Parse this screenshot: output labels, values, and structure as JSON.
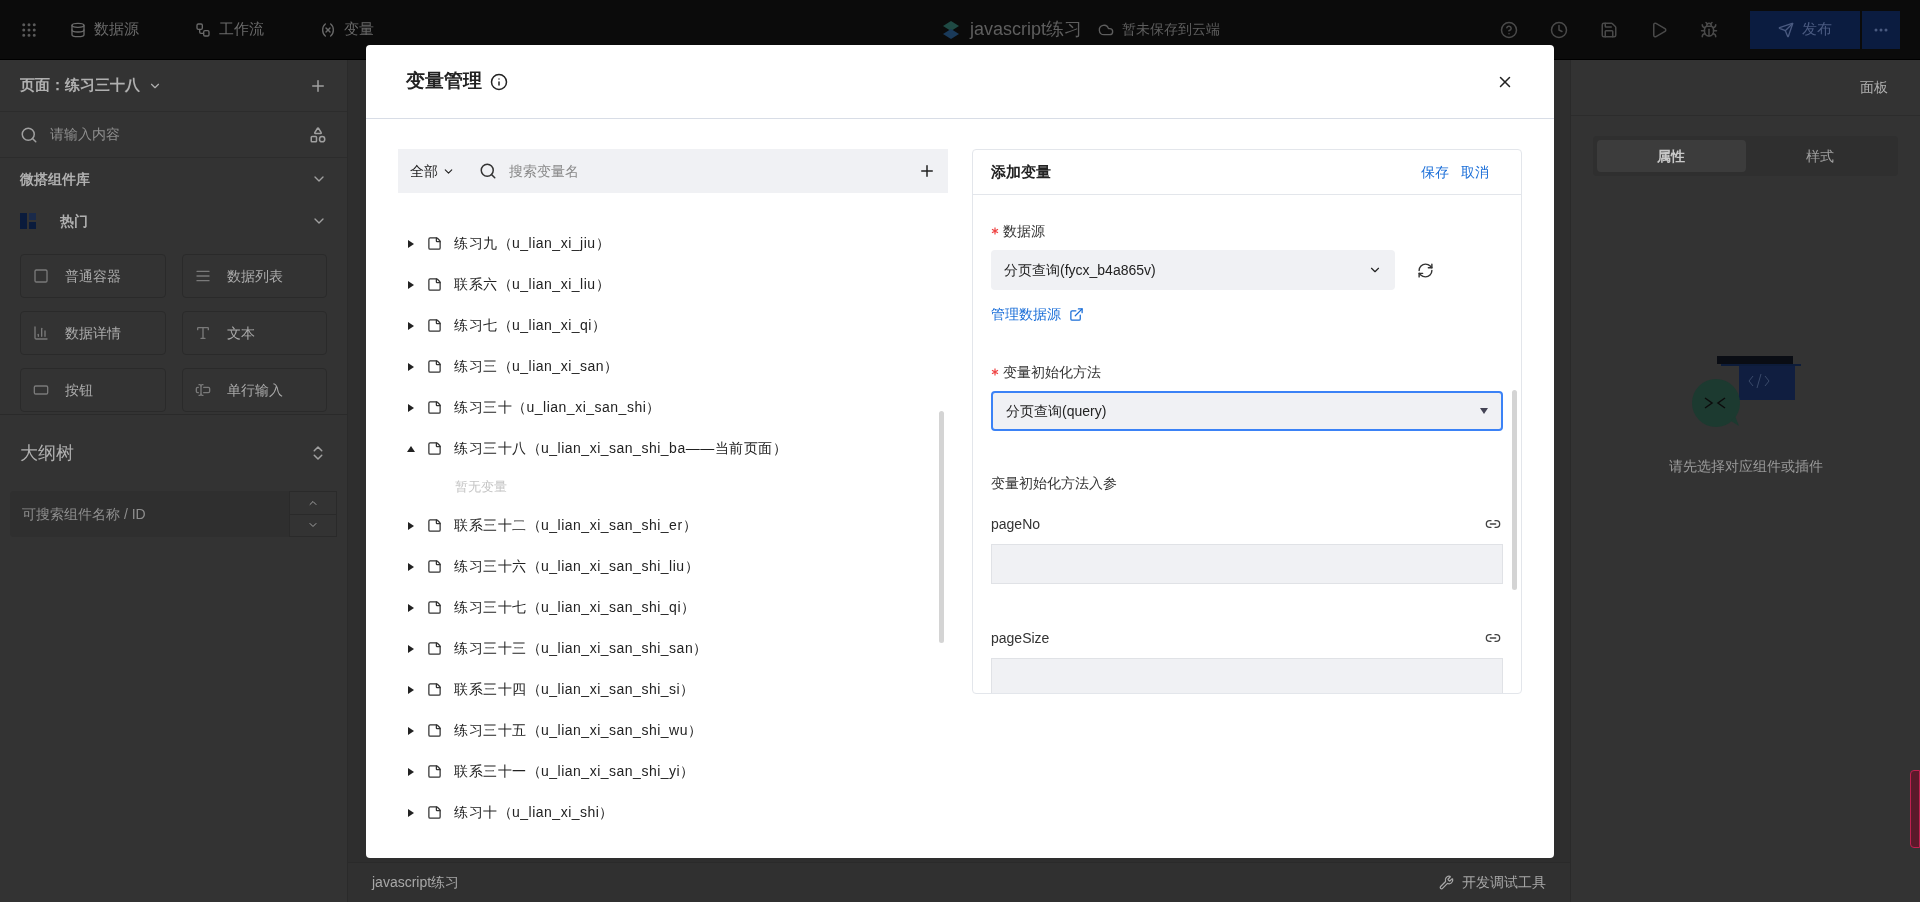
{
  "topbar": {
    "nav": [
      {
        "label": "数据源",
        "kind": "database"
      },
      {
        "label": "工作流",
        "kind": "workflow"
      },
      {
        "label": "变量",
        "kind": "variable"
      }
    ],
    "app_title": "javascript练习",
    "save_status": "暂未保存到云端",
    "publish_button": "发布"
  },
  "left_sidebar": {
    "page_selector": "页面：练习三十八",
    "search": {
      "placeholder": "请输入内容"
    },
    "library_title": "微搭组件库",
    "group_title": "热门",
    "components": [
      {
        "label": "普通容器",
        "kind": "container"
      },
      {
        "label": "数据列表",
        "kind": "list"
      },
      {
        "label": "数据详情",
        "kind": "detail"
      },
      {
        "label": "文本",
        "kind": "text"
      },
      {
        "label": "按钮",
        "kind": "button"
      },
      {
        "label": "单行输入",
        "kind": "input"
      }
    ],
    "outline_title": "大纲树",
    "outline_search": {
      "placeholder": "可搜索组件名称 / ID"
    }
  },
  "canvas_footer": {
    "page_name": "javascript练习",
    "dev_tools": "开发调试工具"
  },
  "right_panel": {
    "title": "面板",
    "tabs": [
      {
        "label": "属性",
        "selected": true
      },
      {
        "label": "样式",
        "selected": false
      }
    ],
    "empty_hint": "请先选择对应组件或插件"
  },
  "modal": {
    "title": "变量管理",
    "filter": "全部",
    "search": {
      "placeholder": "搜索变量名"
    },
    "tree": [
      {
        "label": "练习九（u_lian_xi_jiu）",
        "expanded": false
      },
      {
        "label": "联系六（u_lian_xi_liu）",
        "expanded": false
      },
      {
        "label": "练习七（u_lian_xi_qi）",
        "expanded": false
      },
      {
        "label": "练习三（u_lian_xi_san）",
        "expanded": false
      },
      {
        "label": "练习三十（u_lian_xi_san_shi）",
        "expanded": false
      },
      {
        "label": "练习三十八（u_lian_xi_san_shi_ba——当前页面）",
        "expanded": true,
        "empty_text": "暂无变量"
      },
      {
        "label": "联系三十二（u_lian_xi_san_shi_er）",
        "expanded": false
      },
      {
        "label": "练习三十六（u_lian_xi_san_shi_liu）",
        "expanded": false
      },
      {
        "label": "练习三十七（u_lian_xi_san_shi_qi）",
        "expanded": false
      },
      {
        "label": "练习三十三（u_lian_xi_san_shi_san）",
        "expanded": false
      },
      {
        "label": "联系三十四（u_lian_xi_san_shi_si）",
        "expanded": false
      },
      {
        "label": "练习三十五（u_lian_xi_san_shi_wu）",
        "expanded": false
      },
      {
        "label": "联系三十一（u_lian_xi_san_shi_yi）",
        "expanded": false
      },
      {
        "label": "练习十（u_lian_xi_shi）",
        "expanded": false
      }
    ],
    "form": {
      "title": "添加变量",
      "actions": [
        "保存",
        "取消"
      ],
      "datasource": {
        "label": "数据源",
        "required": true,
        "value": "分页查询(fycx_b4a865v)"
      },
      "manage_link": "管理数据源",
      "init_method": {
        "label": "变量初始化方法",
        "required": true,
        "value": "分页查询(query)",
        "focused": true
      },
      "params_title": "变量初始化方法入参",
      "params": [
        {
          "name": "pageNo"
        },
        {
          "name": "pageSize"
        }
      ]
    }
  }
}
